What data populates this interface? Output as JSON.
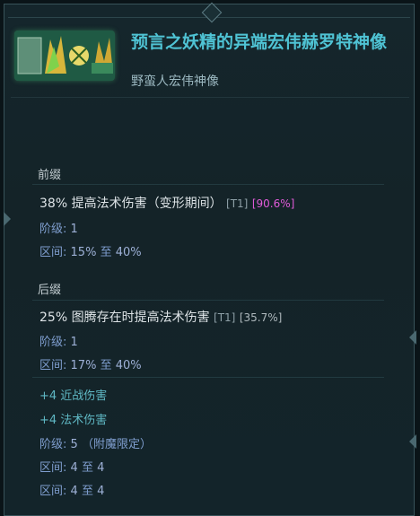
{
  "item": {
    "name": "预言之妖精的异端宏伟赫罗特神像",
    "base_type": "野蛮人宏伟神像"
  },
  "prefix": {
    "title": "前缀",
    "mod": "38% 提高法术伤害（变形期间）",
    "tier": "[T1]",
    "roll": "[90.6%]",
    "level_label": "阶级:",
    "level_value": "1",
    "range_label": "区间:",
    "range_low": "15%",
    "range_to": "至",
    "range_high": "40%"
  },
  "suffix": {
    "title": "后缀",
    "mod": "25% 图腾存在时提高法术伤害",
    "tier": "[T1]",
    "roll": "[35.7%]",
    "level_label": "阶级:",
    "level_value": "1",
    "range_label": "区间:",
    "range_low": "17%",
    "range_to": "至",
    "range_high": "40%"
  },
  "implicit": {
    "line1": "+4 近战伤害",
    "line2": "+4 法术伤害",
    "level_label": "阶级:",
    "level_value": "5",
    "level_note": "（附魔限定）",
    "range1_label": "区间:",
    "range1_low": "4",
    "range1_to": "至",
    "range1_high": "4",
    "range2_label": "区间:",
    "range2_low": "4",
    "range2_to": "至",
    "range2_high": "4"
  },
  "colors": {
    "item_name": "#4fc3d4",
    "roll_highlight": "#e05bd8",
    "info": "#7f9ecf",
    "implicit": "#5fb8c4"
  }
}
